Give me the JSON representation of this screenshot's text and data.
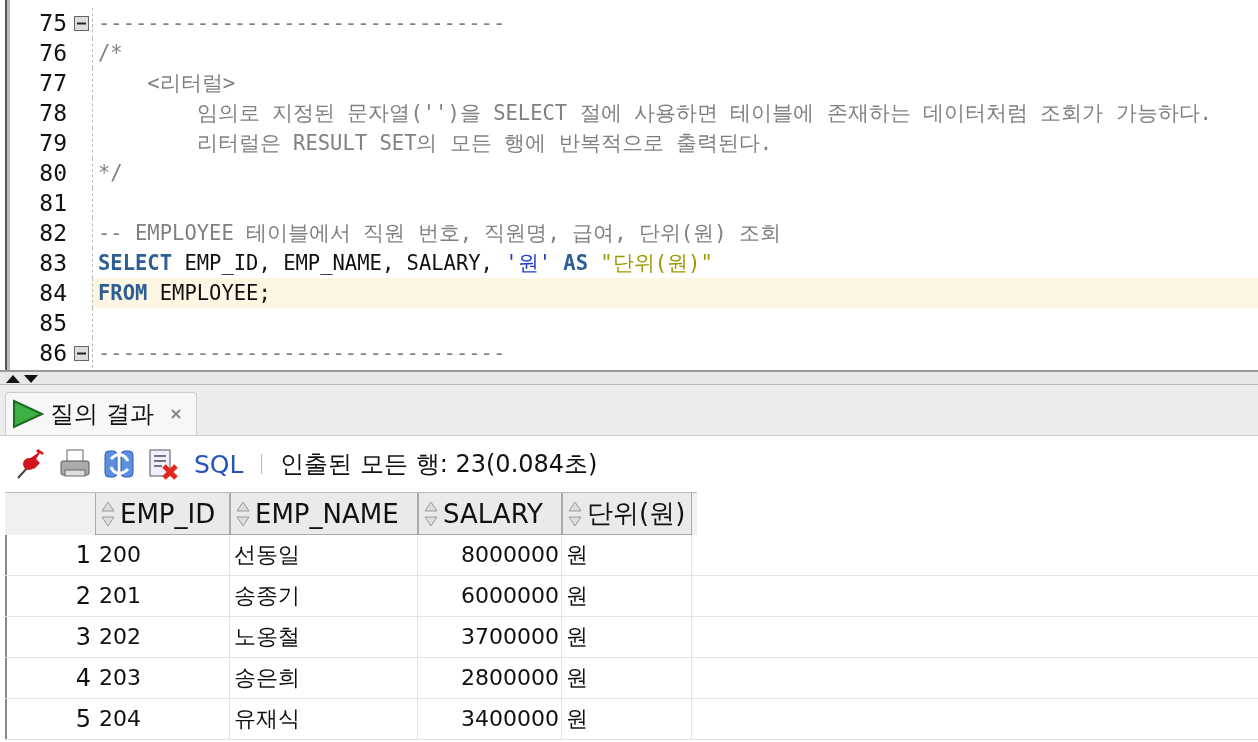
{
  "editor": {
    "lines": [
      {
        "number": "75",
        "fold": true,
        "current": false,
        "tokens": [
          {
            "kind": "comment",
            "text": "---------------------------------"
          }
        ]
      },
      {
        "number": "76",
        "fold": false,
        "current": false,
        "tokens": [
          {
            "kind": "comment",
            "text": "/*"
          }
        ]
      },
      {
        "number": "77",
        "fold": false,
        "current": false,
        "tokens": [
          {
            "kind": "comment",
            "text": "    <리터럴>"
          }
        ]
      },
      {
        "number": "78",
        "fold": false,
        "current": false,
        "tokens": [
          {
            "kind": "comment",
            "text": "        임의로 지정된 문자열('')을 SELECT 절에 사용하면 테이블에 존재하는 데이터처럼 조회가 가능하다."
          }
        ]
      },
      {
        "number": "79",
        "fold": false,
        "current": false,
        "tokens": [
          {
            "kind": "comment",
            "text": "        리터럴은 RESULT SET의 모든 행에 반복적으로 출력된다."
          }
        ]
      },
      {
        "number": "80",
        "fold": false,
        "current": false,
        "tokens": [
          {
            "kind": "comment",
            "text": "*/"
          }
        ]
      },
      {
        "number": "81",
        "fold": false,
        "current": false
      },
      {
        "number": "82",
        "fold": false,
        "current": false,
        "tokens": [
          {
            "kind": "comment",
            "text": "-- EMPLOYEE 테이블에서 직원 번호, 직원명, 급여, 단위(원) 조회"
          }
        ]
      },
      {
        "number": "83",
        "fold": false,
        "current": false,
        "tokens": [
          {
            "kind": "keyword",
            "text": "SELECT"
          },
          {
            "kind": "plain",
            "text": " EMP_ID, EMP_NAME, SALARY, "
          },
          {
            "kind": "string",
            "text": "'원'"
          },
          {
            "kind": "keyword",
            "text": " AS"
          },
          {
            "kind": "alias",
            "text": " \"단위(원)\""
          }
        ]
      },
      {
        "number": "84",
        "fold": false,
        "current": true,
        "tokens": [
          {
            "kind": "keyword",
            "text": "FROM"
          },
          {
            "kind": "plain",
            "text": " EMPLOYEE;"
          }
        ]
      },
      {
        "number": "85",
        "fold": false,
        "current": false
      },
      {
        "number": "86",
        "fold": true,
        "current": false,
        "tokens": [
          {
            "kind": "comment",
            "text": "---------------------------------"
          }
        ]
      }
    ]
  },
  "results": {
    "tabs": [
      {
        "label": "질의 결과",
        "selected": true
      }
    ],
    "toolbar": {
      "sql_link": "SQL",
      "status": "인출된 모든 행: 23(0.084초)"
    },
    "grid": {
      "columns": [
        {
          "label": "EMP_ID",
          "kind": "text"
        },
        {
          "label": "EMP_NAME",
          "kind": "text"
        },
        {
          "label": "SALARY",
          "kind": "number"
        },
        {
          "label": "단위(원)",
          "kind": "text"
        }
      ],
      "rows": [
        {
          "number": "1",
          "cells": [
            "200",
            "선동일",
            "8000000",
            "원"
          ]
        },
        {
          "number": "2",
          "cells": [
            "201",
            "송종기",
            "6000000",
            "원"
          ]
        },
        {
          "number": "3",
          "cells": [
            "202",
            "노옹철",
            "3700000",
            "원"
          ]
        },
        {
          "number": "4",
          "cells": [
            "203",
            "송은희",
            "2800000",
            "원"
          ]
        },
        {
          "number": "5",
          "cells": [
            "204",
            "유재식",
            "3400000",
            "원"
          ]
        }
      ]
    }
  }
}
